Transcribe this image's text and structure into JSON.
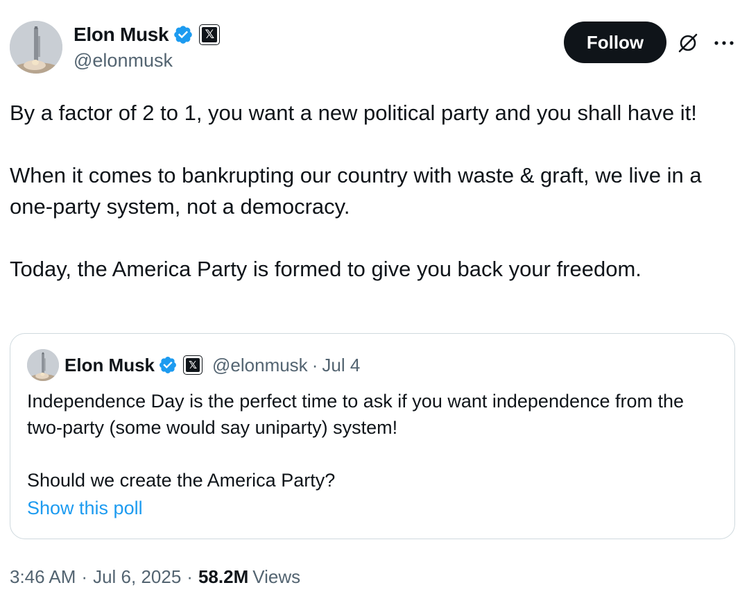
{
  "author": {
    "display_name": "Elon Musk",
    "handle": "@elonmusk",
    "avatar_icon": "rocket-launch-avatar",
    "verified_icon": "verified-badge-icon",
    "affiliate_icon": "x-logo-icon",
    "affiliate_glyph": "𝕏"
  },
  "actions": {
    "follow_label": "Follow",
    "grok_icon": "grok-icon",
    "more_icon": "more-options-icon"
  },
  "tweet": {
    "paragraphs": [
      "By a factor of 2 to 1, you want a new political party and you shall have it!",
      "When it comes to bankrupting our country with waste & graft, we live in a one-party system, not a democracy.",
      "Today, the America Party is formed to give you back your freedom."
    ]
  },
  "quoted_tweet": {
    "display_name": "Elon Musk",
    "handle": "@elonmusk",
    "separator": "·",
    "date": "Jul 4",
    "affiliate_glyph": "𝕏",
    "paragraphs": [
      "Independence Day is the perfect time to ask if you want independence from the two-party (some would say uniparty) system!",
      "Should we create the America Party?"
    ],
    "poll_link": "Show this poll"
  },
  "meta": {
    "time": "3:46 AM",
    "separator": "·",
    "date": "Jul 6, 2025",
    "views_count": "58.2M",
    "views_label": "Views"
  },
  "colors": {
    "text_primary": "#0f1419",
    "text_secondary": "#536471",
    "link": "#1d9bf0",
    "verified": "#1d9bf0",
    "border": "#cfd9de",
    "button_bg": "#0f1419"
  }
}
